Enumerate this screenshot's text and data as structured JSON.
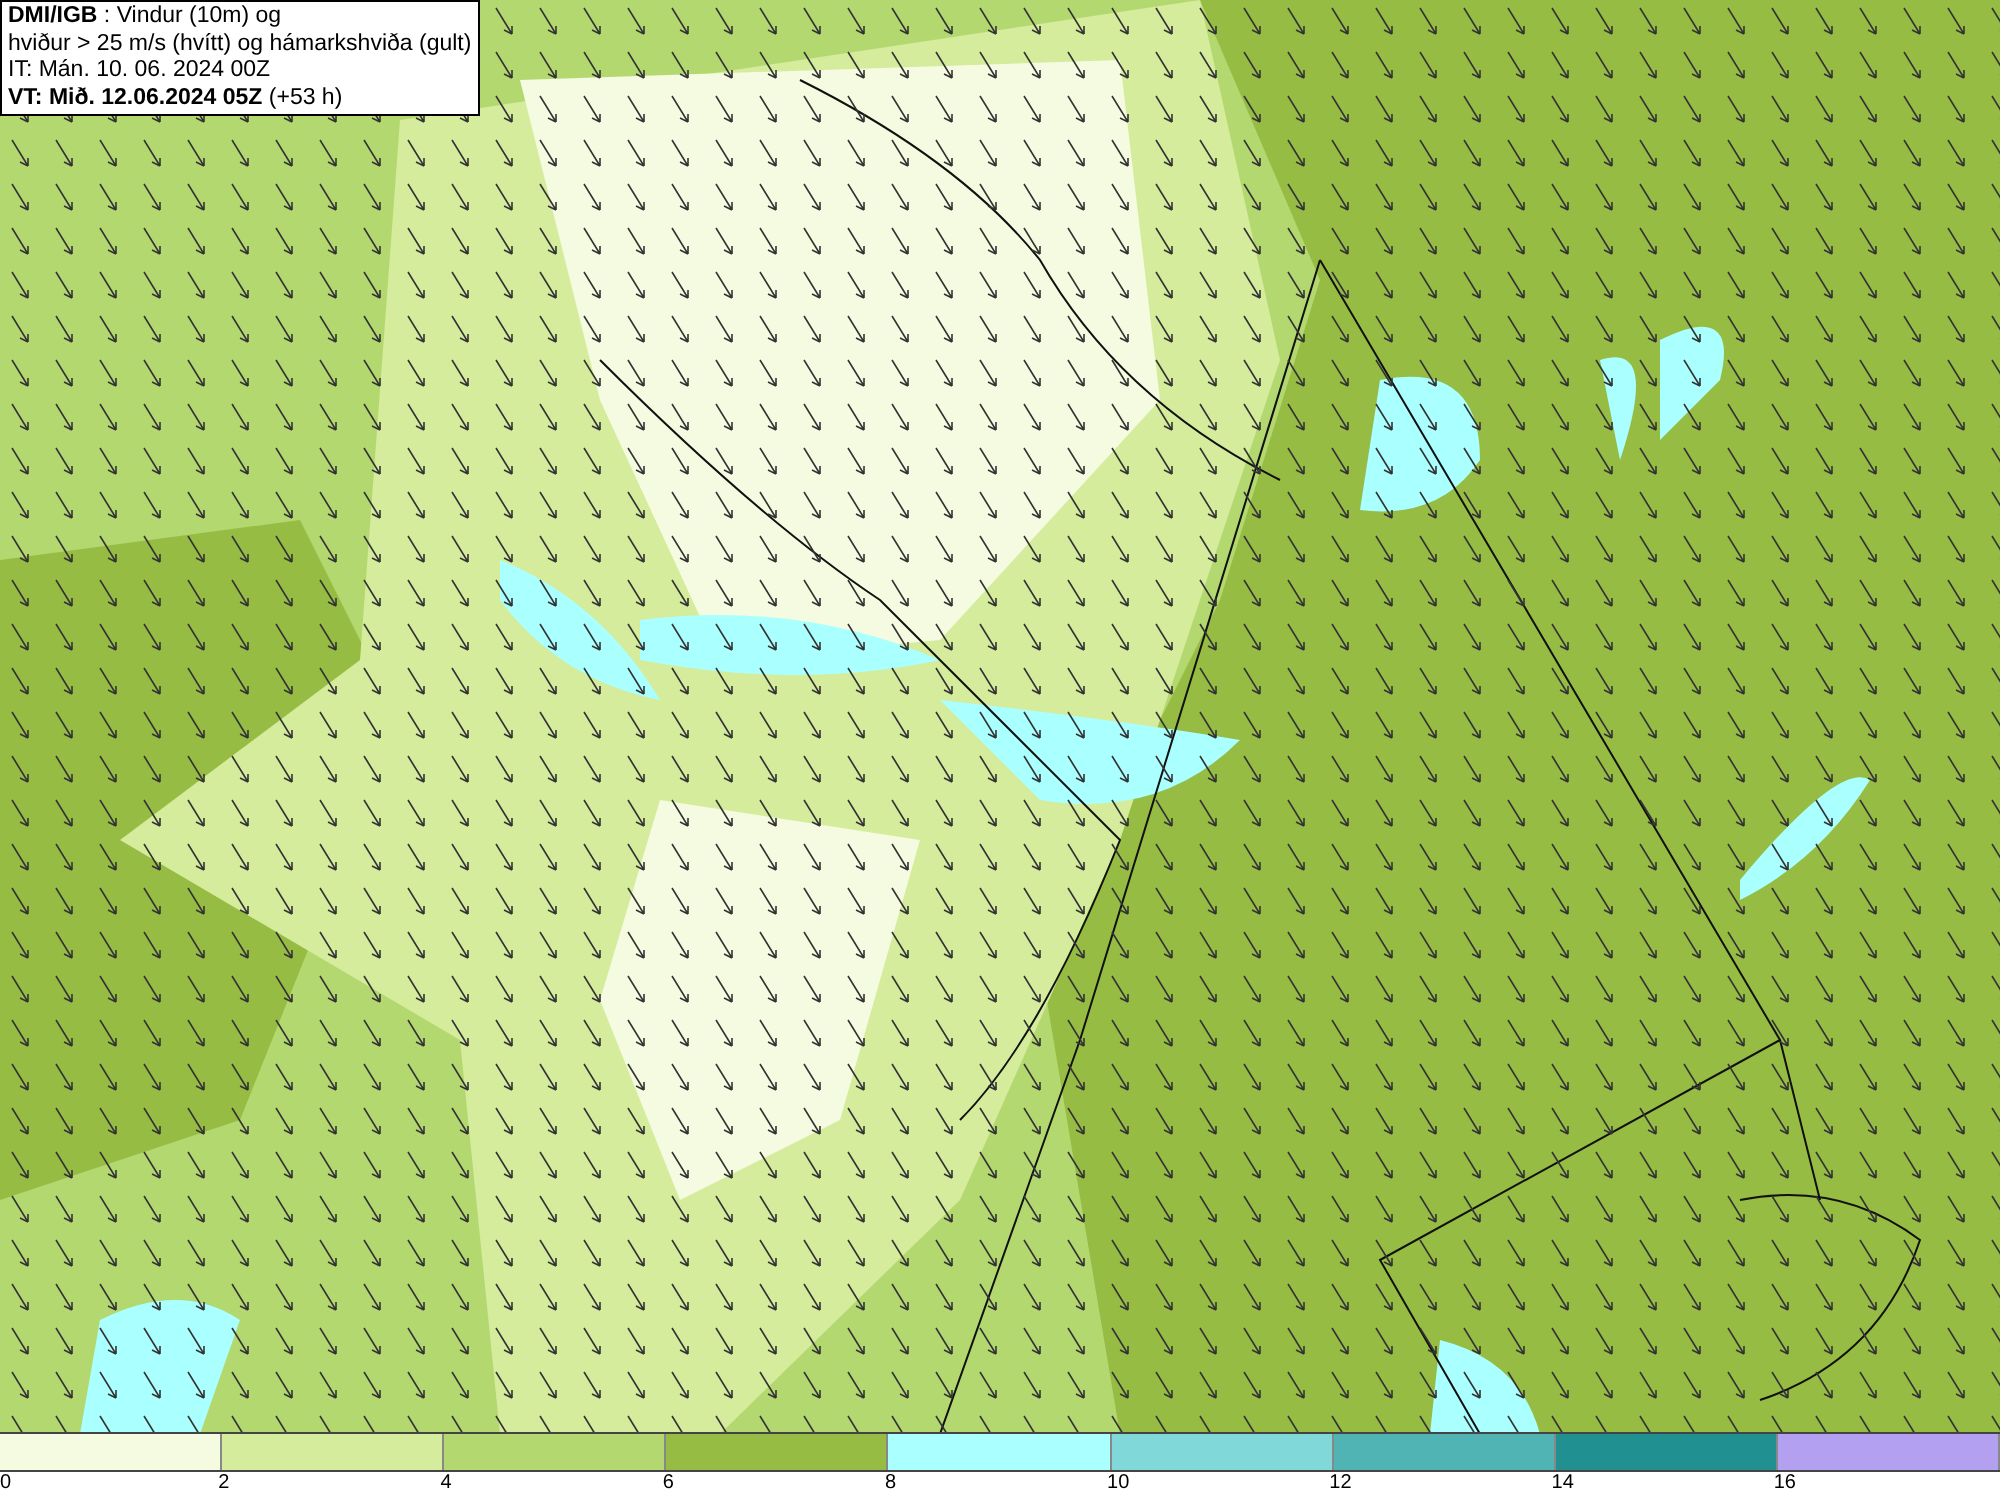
{
  "title_box": {
    "lines": [
      "**DMI/IGB** : Vindur (10m) og",
      "hviður > 25 m/s (hvítt) og hámarkshviða (gult)",
      "IT: Mán. 10. 06. 2024 00Z",
      "**VT: Mið. 12.06.2024 05Z** (+53 h)"
    ]
  },
  "legend": {
    "bins": [
      {
        "label": "0",
        "color": "#f5fbe0"
      },
      {
        "label": "2",
        "color": "#d4ec9c"
      },
      {
        "label": "4",
        "color": "#b4d870"
      },
      {
        "label": "6",
        "color": "#96bc44"
      },
      {
        "label": "8",
        "color": "#aaffff"
      },
      {
        "label": "10",
        "color": "#80d8d8"
      },
      {
        "label": "12",
        "color": "#50b4b4"
      },
      {
        "label": "14",
        "color": "#209090"
      },
      {
        "label": "16",
        "color": "#b4a0f0"
      }
    ]
  }
}
